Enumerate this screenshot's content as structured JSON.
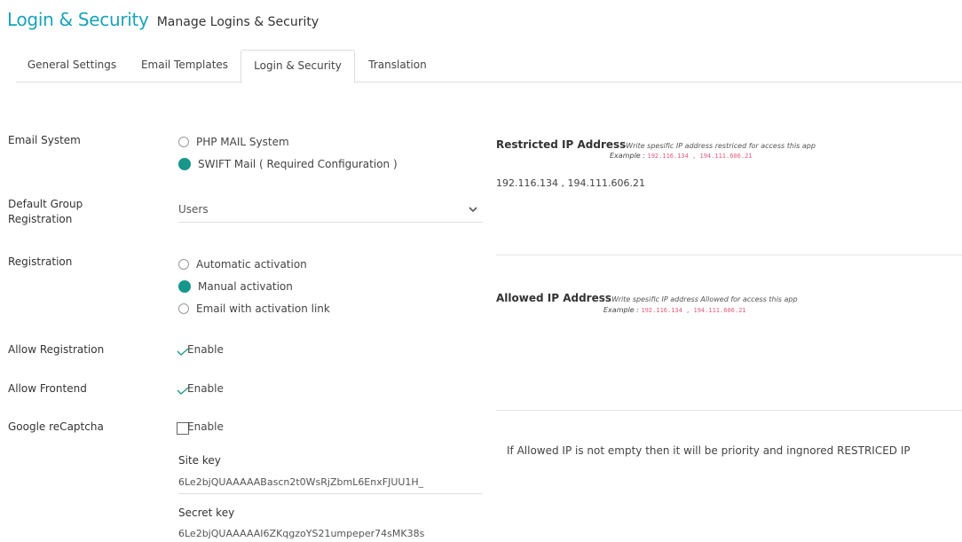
{
  "header": {
    "title": "Login & Security",
    "subtitle": "Manage Logins & Security"
  },
  "tabs": [
    {
      "label": "General Settings",
      "active": false
    },
    {
      "label": "Email Templates",
      "active": false
    },
    {
      "label": "Login & Security",
      "active": true
    },
    {
      "label": "Translation",
      "active": false
    }
  ],
  "email_system": {
    "label": "Email System",
    "options": [
      {
        "label": "PHP MAIL System",
        "checked": false
      },
      {
        "label": "SWIFT Mail ( Required Configuration )",
        "checked": true
      }
    ]
  },
  "default_group": {
    "label_line1": "Default Group",
    "label_line2": "Registration",
    "selected": "Users"
  },
  "registration": {
    "label": "Registration",
    "options": [
      {
        "label": "Automatic activation",
        "checked": false
      },
      {
        "label": "Manual activation",
        "checked": true
      },
      {
        "label": "Email with activation link",
        "checked": false
      }
    ]
  },
  "allow_registration": {
    "label": "Allow Registration",
    "toggle_label": "Enable",
    "checked": true
  },
  "allow_frontend": {
    "label": "Allow Frontend",
    "toggle_label": "Enable",
    "checked": true
  },
  "google_recaptcha": {
    "label": "Google reCaptcha",
    "toggle_label": "Enable",
    "checked": false
  },
  "site_key": {
    "label": "Site key",
    "value": "6Le2bjQUAAAAABascn2t0WsRjZbmL6EnxFJUU1H_"
  },
  "secret_key": {
    "label": "Secret key",
    "value": "6Le2bjQUAAAAAI6ZKqgzoYS21umpeper74sMK38s"
  },
  "restricted_ip": {
    "title": "Restricted IP Address",
    "hint": "Write spesific IP address restriced for access this app",
    "example_label": "Example :",
    "example_value": "192.116.134 , 194.111.606.21",
    "value": "192.116.134 , 194.111.606.21"
  },
  "allowed_ip": {
    "title": "Allowed IP Address",
    "hint": "Write spesific IP address Allowed for access this app",
    "example_label": "Example :",
    "example_value": "192.116.134 , 194.111.606.21"
  },
  "note": "If Allowed IP is not empty then it will be priority and ingnored RESTRICED IP",
  "colors": {
    "accent": "#1aa3b8",
    "radio_checked": "#17968a",
    "example_code": "#e05a7a"
  }
}
